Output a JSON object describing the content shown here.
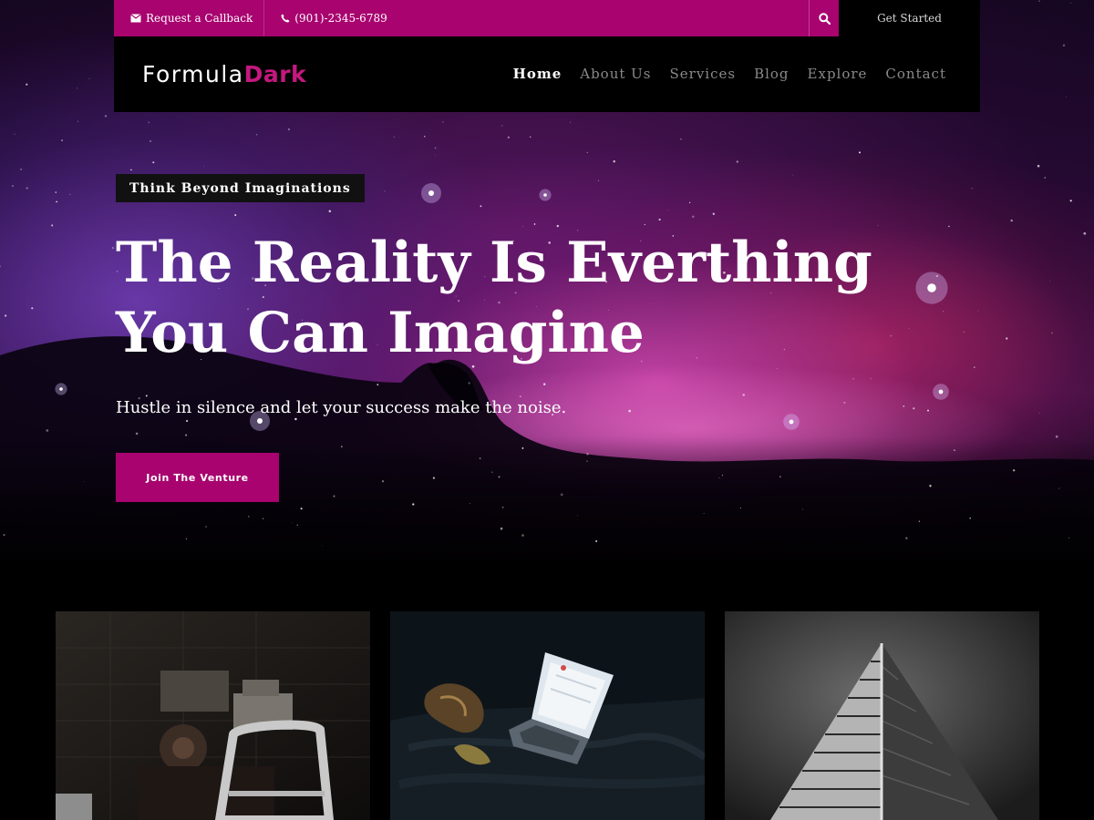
{
  "topbar": {
    "callback_label": "Request a Callback",
    "phone": "(901)-2345-6789",
    "get_started_label": "Get Started",
    "icons": [
      "envelope-icon",
      "phone-icon",
      "search-icon"
    ]
  },
  "header": {
    "logo_main": "Formula",
    "logo_accent": "Dark",
    "nav": [
      {
        "label": "Home",
        "active": true
      },
      {
        "label": "About Us",
        "active": false
      },
      {
        "label": "Services",
        "active": false
      },
      {
        "label": "Blog",
        "active": false
      },
      {
        "label": "Explore",
        "active": false
      },
      {
        "label": "Contact",
        "active": false
      }
    ]
  },
  "hero": {
    "tagline": "Think Beyond Imaginations",
    "headline": "The Reality Is Everthing You Can Imagine",
    "subtext": "Hustle in silence and let your success make the noise.",
    "cta_label": "Join The Venture"
  },
  "colors": {
    "accent": "#a8036f",
    "logo_accent": "#c4187f",
    "nav_inactive": "#8a8a8a",
    "background": "#000000"
  },
  "cards": [
    {
      "image": "machinery-photo"
    },
    {
      "image": "laptop-photo"
    },
    {
      "image": "building-photo"
    }
  ]
}
